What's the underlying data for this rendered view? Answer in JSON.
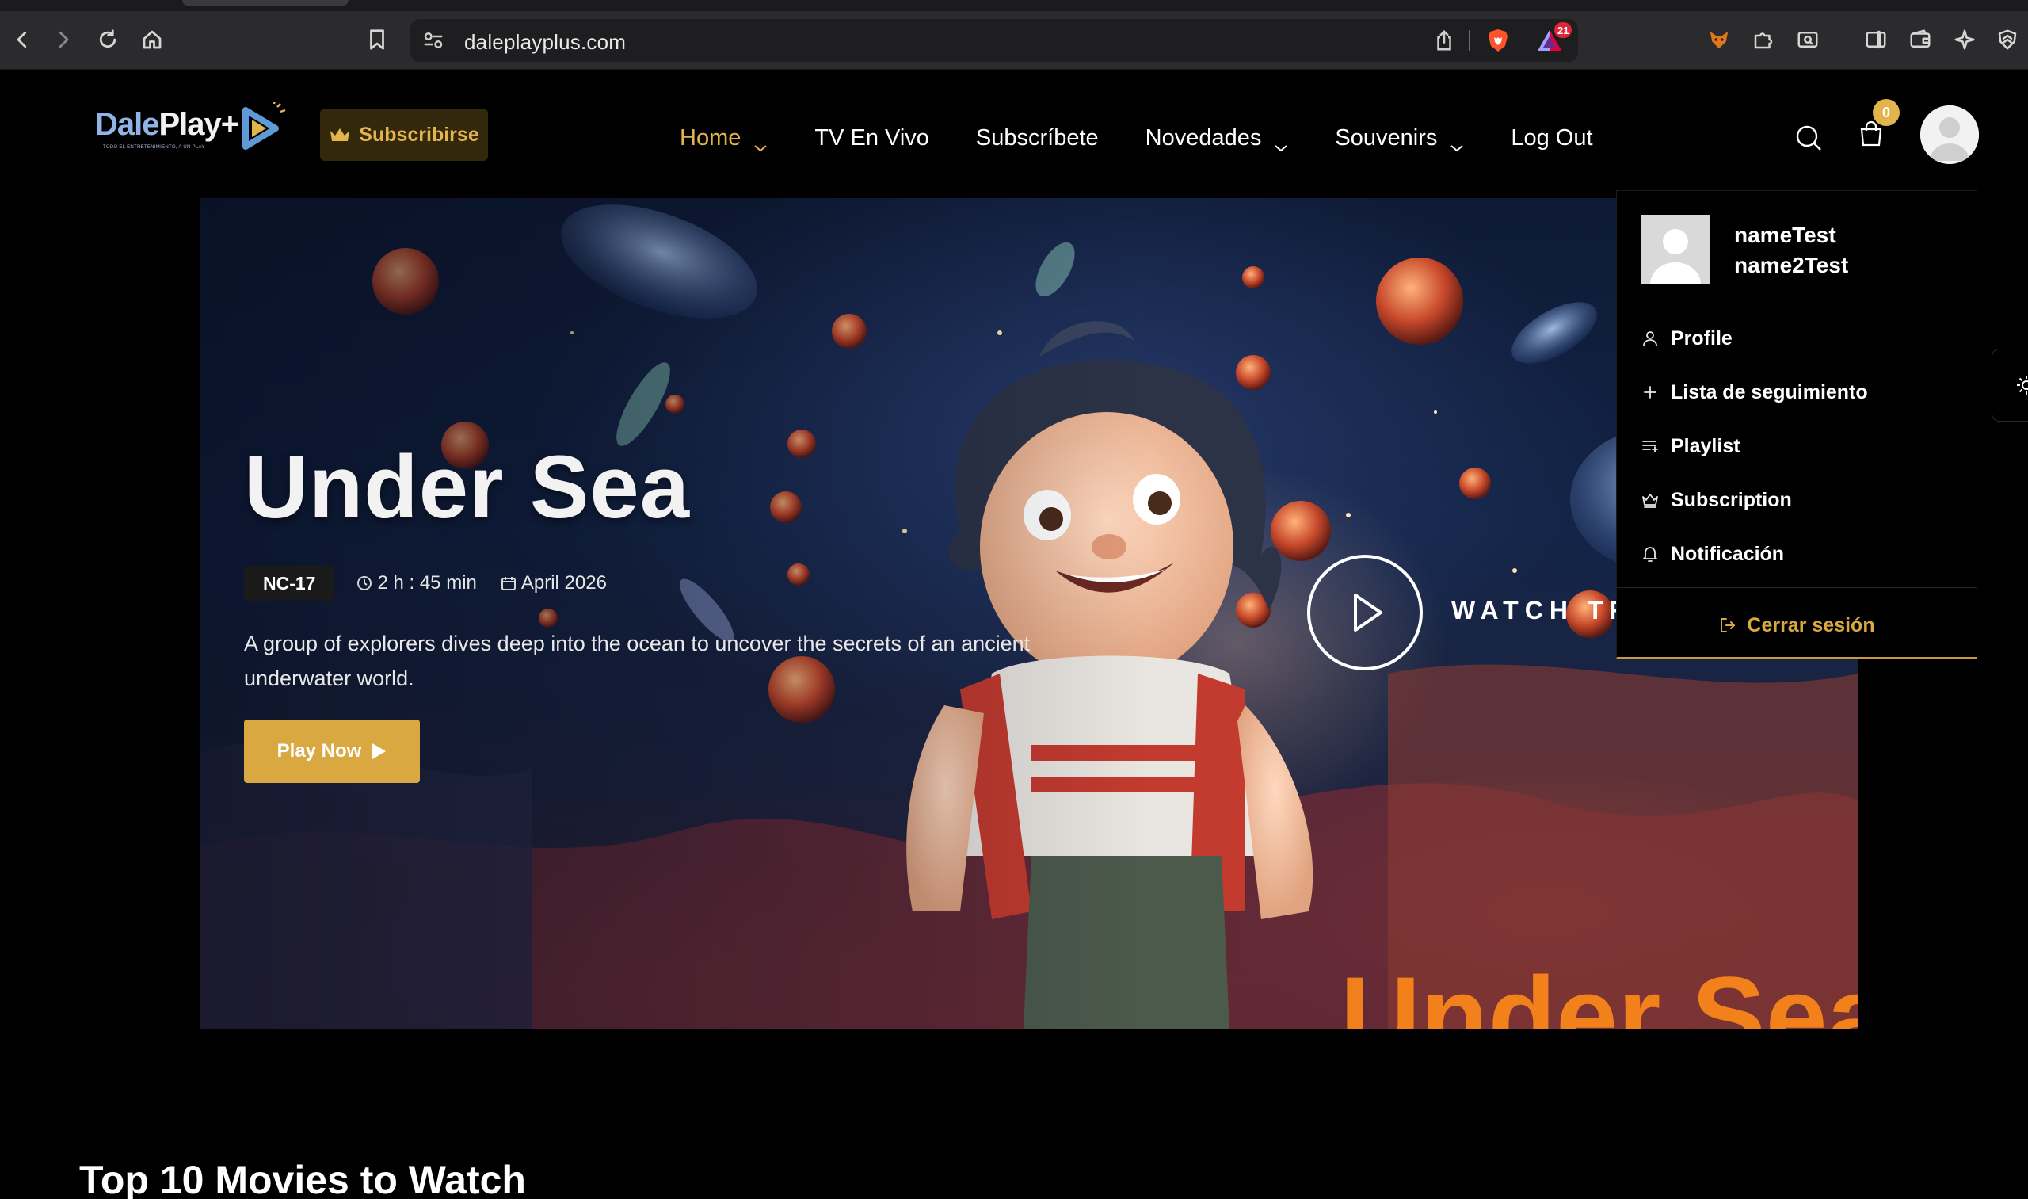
{
  "browser": {
    "url": "daleplayplus.com",
    "rewards_badge": "21"
  },
  "header": {
    "logo_brand_a": "Dale",
    "logo_brand_b": "Play+",
    "logo_tagline": "TODO EL ENTRETENIMIENTO, A UN PLAY",
    "subscribe_label": "Subscribirse",
    "nav": [
      {
        "label": "Home",
        "active": true,
        "has_dropdown": true
      },
      {
        "label": "TV En Vivo",
        "active": false,
        "has_dropdown": false
      },
      {
        "label": "Subscríbete",
        "active": false,
        "has_dropdown": false
      },
      {
        "label": "Novedades",
        "active": false,
        "has_dropdown": true
      },
      {
        "label": "Souvenirs",
        "active": false,
        "has_dropdown": true
      },
      {
        "label": "Log Out",
        "active": false,
        "has_dropdown": false
      }
    ],
    "cart_count": "0"
  },
  "hero": {
    "title": "Under Sea",
    "rating": "NC-17",
    "duration": "2 h : 45 min",
    "release": "April 2026",
    "description": "A group of explorers dives deep into the ocean to uncover the secrets of an ancient underwater world.",
    "play_label": "Play Now",
    "trailer_label": "WATCH TRAILER"
  },
  "profile_menu": {
    "first_name": "nameTest",
    "last_name": "name2Test",
    "items": [
      {
        "label": "Profile",
        "icon": "user-icon"
      },
      {
        "label": "Lista de seguimiento",
        "icon": "plus-icon"
      },
      {
        "label": "Playlist",
        "icon": "playlist-icon"
      },
      {
        "label": "Subscription",
        "icon": "crown-icon"
      },
      {
        "label": "Notificación",
        "icon": "bell-icon"
      }
    ],
    "logout_label": "Cerrar sesión"
  },
  "section": {
    "title": "Top 10 Movies to Watch"
  },
  "colors": {
    "accent": "#d9a841",
    "nav_active": "#e3b44b",
    "background": "#000000"
  }
}
